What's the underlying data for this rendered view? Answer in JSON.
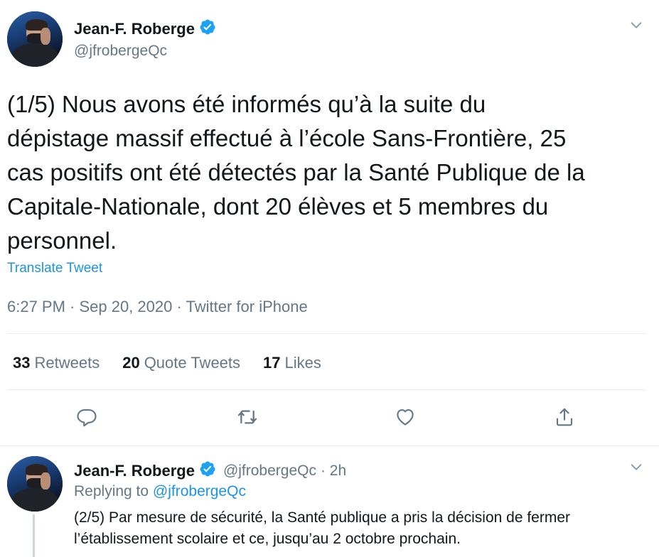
{
  "tweet": {
    "author": {
      "name": "Jean-F. Roberge",
      "handle": "@jfrobergeQc",
      "verified": true
    },
    "text_lines": [
      "(1/5) Nous avons été informés qu’à la suite du",
      "dépistage massif effectué à l’école Sans-Frontière, 25",
      "cas positifs ont été détectés par la Santé Publique de la",
      "Capitale-Nationale, dont 20 élèves et 5 membres du",
      "personnel."
    ],
    "translate_label": "Translate Tweet",
    "meta": "6:27 PM · Sep 20, 2020 · Twitter for iPhone",
    "stats": {
      "retweets": {
        "count": "33",
        "label": "Retweets"
      },
      "quotes": {
        "count": "20",
        "label": "Quote Tweets"
      },
      "likes": {
        "count": "17",
        "label": "Likes"
      }
    },
    "actions": [
      "reply-icon",
      "retweet-icon",
      "like-icon",
      "share-icon"
    ]
  },
  "reply": {
    "author": {
      "name": "Jean-F. Roberge",
      "handle": "@jfrobergeQc",
      "verified": true
    },
    "time": "· 2h",
    "replying_prefix": "Replying to",
    "replying_to": "@jfrobergeQc",
    "text_lines": [
      "(2/5) Par mesure de sécurité, la Santé publique a pris la décision de fermer",
      "l’établissement scolaire et ce, jusqu’au 2 octobre prochain."
    ]
  },
  "colors": {
    "accent": "#1da1f2",
    "link": "#1b95e0",
    "secondary_text": "#657786",
    "divider": "#e6ecf0"
  }
}
